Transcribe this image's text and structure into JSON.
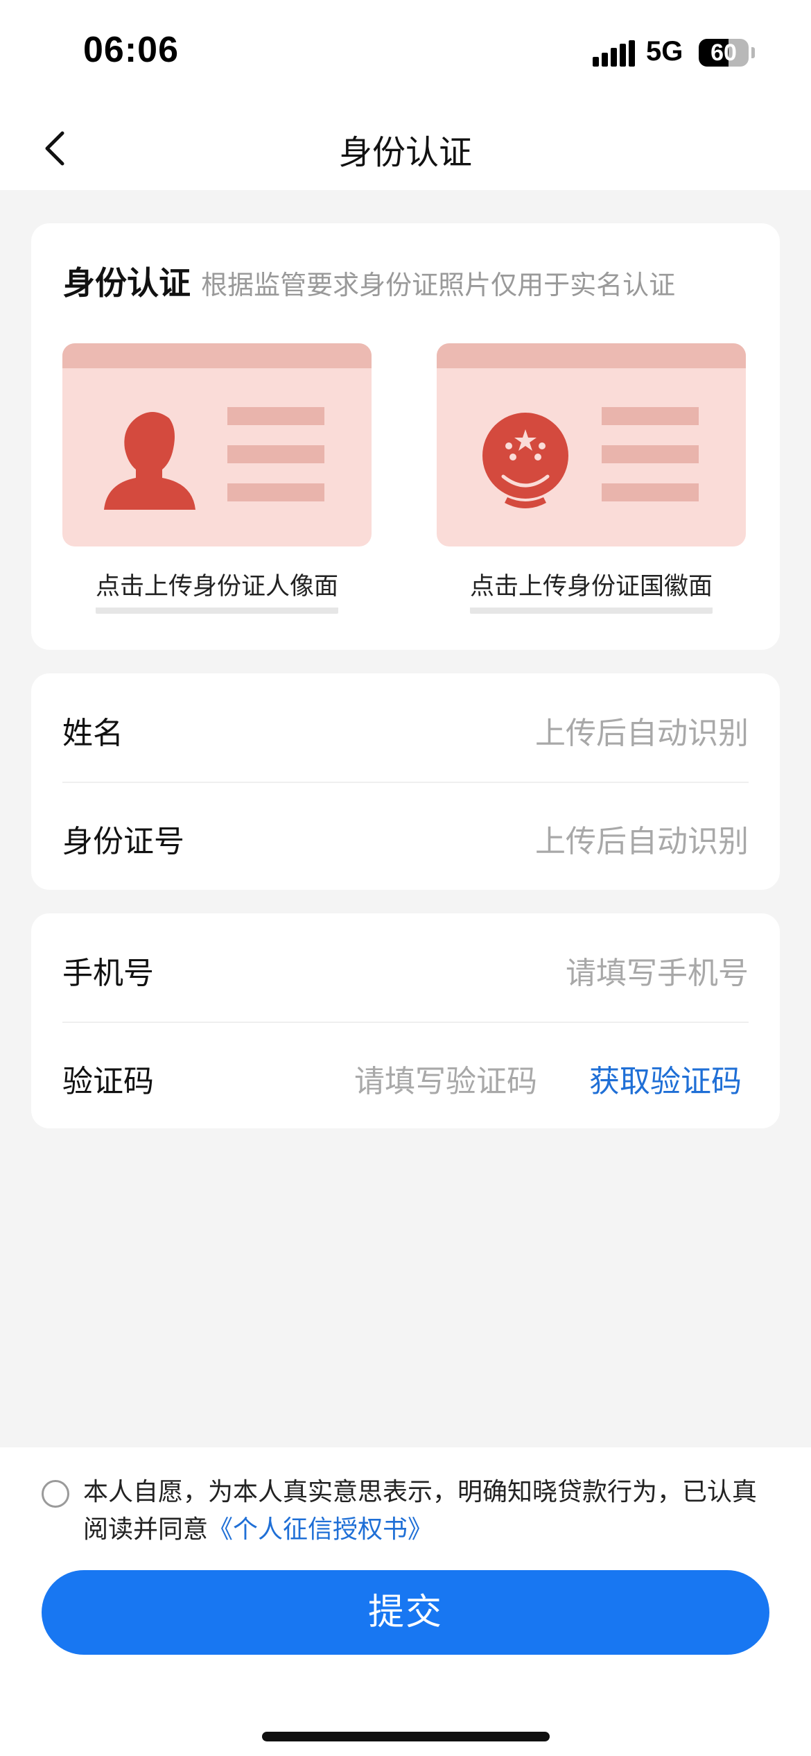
{
  "status_bar": {
    "time": "06:06",
    "network": "5G",
    "battery": "60",
    "battery_level": 0.6
  },
  "nav": {
    "back_icon": "chevron-left-icon",
    "title": "身份认证"
  },
  "upload": {
    "title": "身份认证",
    "hint": "根据监管要求身份证照片仅用于实名认证",
    "front_caption": "点击上传身份证人像面",
    "back_caption": "点击上传身份证国徽面",
    "front_icon": "id-portrait-icon",
    "back_icon": "national-emblem-icon",
    "tile_color": "#fadcd8",
    "accent_color": "#d44a3e"
  },
  "identity": {
    "name_label": "姓名",
    "name_placeholder": "上传后自动识别",
    "id_label": "身份证号",
    "id_placeholder": "上传后自动识别"
  },
  "phone": {
    "phone_label": "手机号",
    "phone_placeholder": "请填写手机号",
    "code_label": "验证码",
    "code_placeholder": "请填写验证码",
    "get_code": "获取验证码"
  },
  "agreement": {
    "text": "本人自愿，为本人真实意思表示，明确知晓贷款行为，已认真阅读并同意",
    "link": "《个人征信授权书》",
    "checked": false
  },
  "submit_label": "提交",
  "colors": {
    "primary": "#1877f2",
    "link": "#1f6fd6",
    "background": "#f4f4f4"
  }
}
